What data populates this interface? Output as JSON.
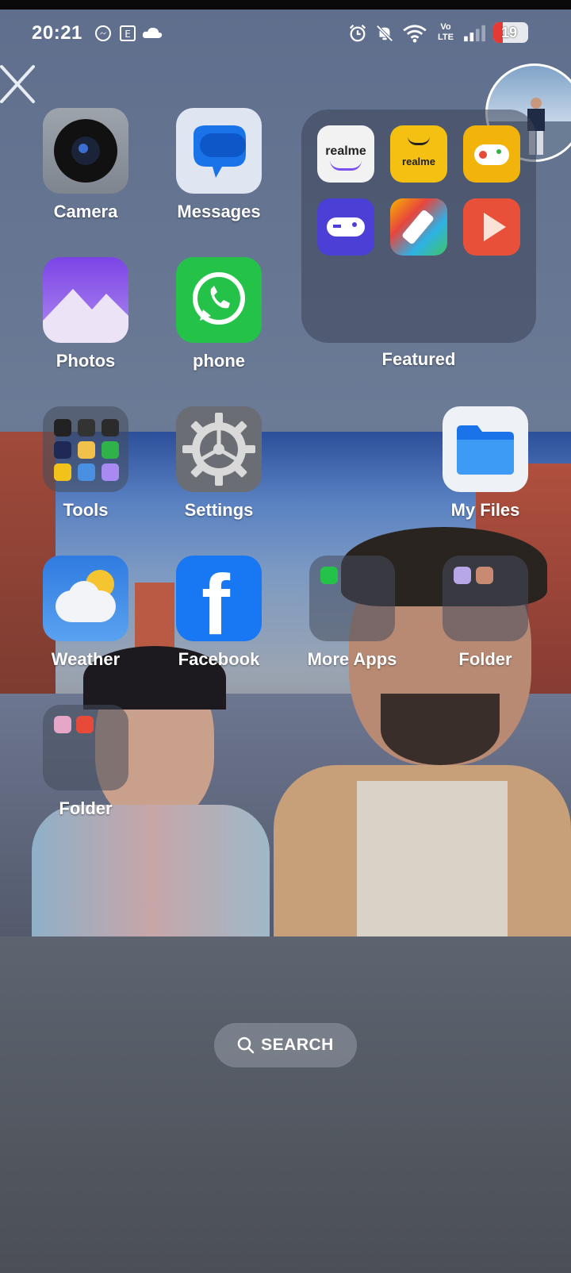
{
  "status_bar": {
    "time": "20:21",
    "network": "Vo LTE",
    "battery": "19",
    "battery_color": "#e53935"
  },
  "apps": {
    "camera": "Camera",
    "messages": "Messages",
    "photos": "Photos",
    "phone": "phone",
    "featured": "Featured",
    "tools": "Tools",
    "settings": "Settings",
    "my_files": "My Files",
    "weather": "Weather",
    "facebook": "Facebook",
    "more_apps": "More Apps",
    "folder1": "Folder",
    "folder2": "Folder"
  },
  "featured_items": [
    "realme",
    "realme"
  ],
  "search": {
    "label": "SEARCH"
  },
  "colors": {
    "accent_blue": "#1a73e8",
    "whatsapp_green": "#25d366",
    "facebook_blue": "#1877f2"
  }
}
